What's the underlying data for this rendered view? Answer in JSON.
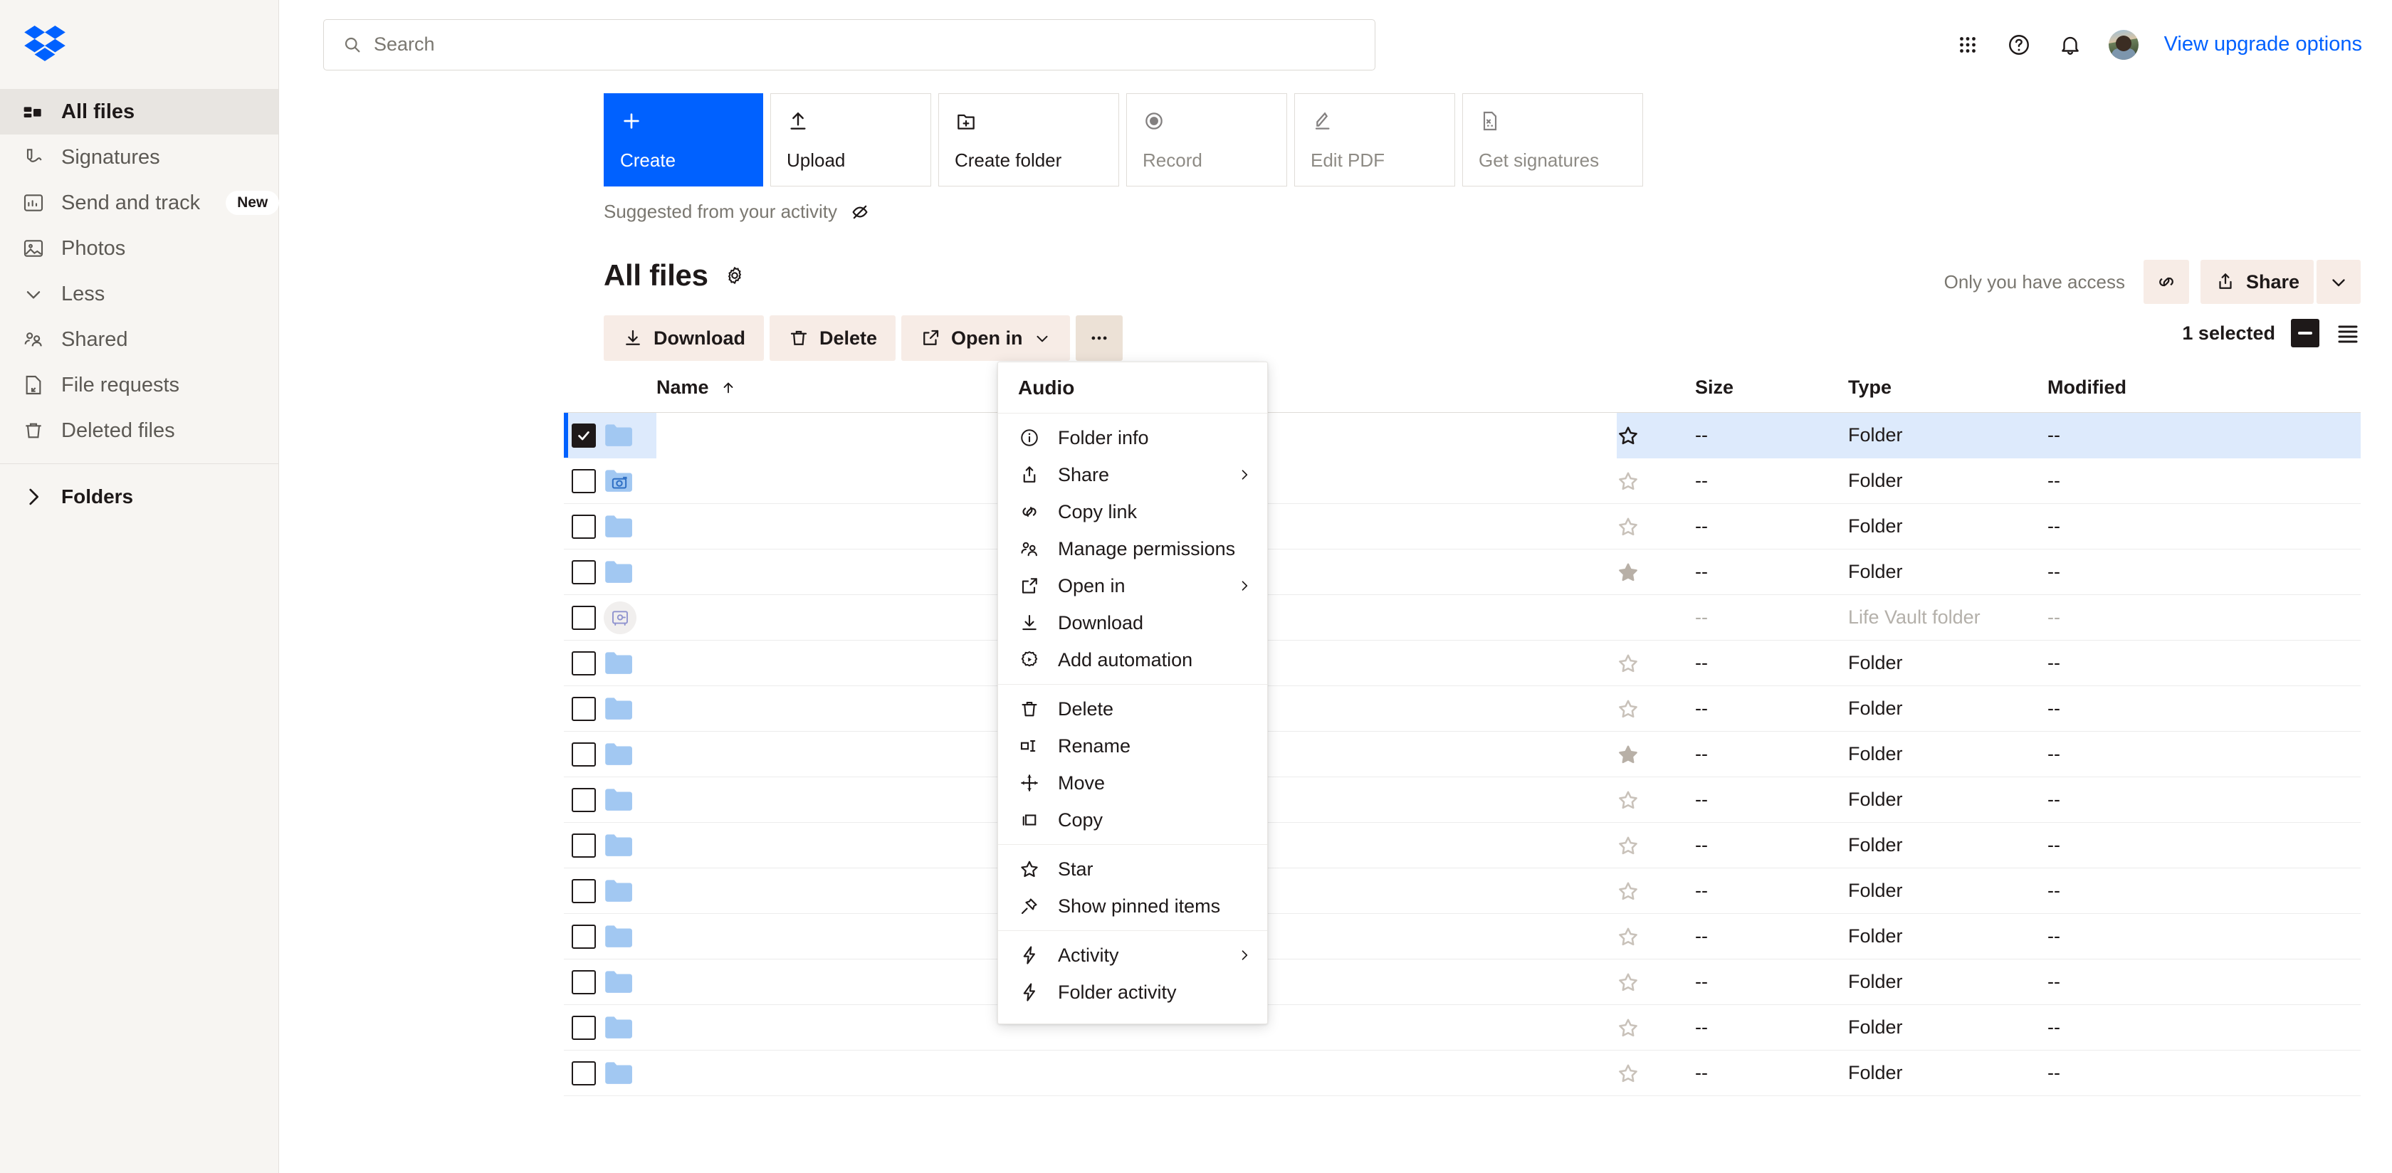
{
  "brand": {
    "name": "Dropbox",
    "accent": "#0061ff"
  },
  "sidebar": {
    "items": [
      {
        "label": "All files",
        "icon": "all-files-icon",
        "active": true,
        "badge": ""
      },
      {
        "label": "Signatures",
        "icon": "signature-icon",
        "active": false,
        "badge": ""
      },
      {
        "label": "Send and track",
        "icon": "send-track-icon",
        "active": false,
        "badge": "New"
      },
      {
        "label": "Photos",
        "icon": "photos-icon",
        "active": false,
        "badge": ""
      },
      {
        "label": "Less",
        "icon": "chevron-down-icon",
        "active": false,
        "badge": ""
      },
      {
        "label": "Shared",
        "icon": "shared-icon",
        "active": false,
        "badge": ""
      },
      {
        "label": "File requests",
        "icon": "file-request-icon",
        "active": false,
        "badge": ""
      },
      {
        "label": "Deleted files",
        "icon": "trash-icon",
        "active": false,
        "badge": ""
      }
    ],
    "folders_label": "Folders"
  },
  "topbar": {
    "search_placeholder": "Search",
    "upgrade_label": "View upgrade options",
    "icons": [
      "grid-apps-icon",
      "help-circle-icon",
      "bell-icon",
      "avatar"
    ]
  },
  "tiles": [
    {
      "label": "Create",
      "icon": "plus-icon",
      "primary": true,
      "disabled": false
    },
    {
      "label": "Upload",
      "icon": "upload-icon",
      "primary": false,
      "disabled": false
    },
    {
      "label": "Create folder",
      "icon": "folder-plus-icon",
      "primary": false,
      "disabled": false
    },
    {
      "label": "Record",
      "icon": "record-icon",
      "primary": false,
      "disabled": true
    },
    {
      "label": "Edit PDF",
      "icon": "pen-icon",
      "primary": false,
      "disabled": true
    },
    {
      "label": "Get signatures",
      "icon": "signature-doc-icon",
      "primary": false,
      "disabled": true
    }
  ],
  "suggested": {
    "label": "Suggested from your activity",
    "icon": "hide-eye-icon"
  },
  "page": {
    "title": "All files",
    "settings_icon": "gear-icon",
    "access_label": "Only you have access",
    "copy_link_icon": "link-icon",
    "share_label": "Share",
    "share_caret_icon": "chevron-down-icon"
  },
  "actionbar": {
    "download_label": "Download",
    "delete_label": "Delete",
    "open_in_label": "Open in",
    "more_label": "•••"
  },
  "selection": {
    "count_label": "1 selected",
    "deselect_icon": "minus-icon",
    "view_toggle_icon": "list-view-icon"
  },
  "table": {
    "headers": {
      "name": "Name",
      "size": "Size",
      "type": "Type",
      "modified": "Modified"
    },
    "sort": {
      "column": "Name",
      "direction": "asc",
      "icon": "arrow-up-icon"
    },
    "rows": [
      {
        "name": "",
        "icon": "folder-icon",
        "checked": true,
        "starred": "outline-dark",
        "size": "--",
        "type": "Folder",
        "modified": "--",
        "selected": true,
        "dim": false
      },
      {
        "name": "",
        "icon": "camera-folder-icon",
        "checked": false,
        "starred": "outline",
        "size": "--",
        "type": "Folder",
        "modified": "--",
        "selected": false,
        "dim": false
      },
      {
        "name": "",
        "icon": "folder-icon",
        "checked": false,
        "starred": "outline",
        "size": "--",
        "type": "Folder",
        "modified": "--",
        "selected": false,
        "dim": false
      },
      {
        "name": "",
        "icon": "folder-icon",
        "checked": false,
        "starred": "filled",
        "size": "--",
        "type": "Folder",
        "modified": "--",
        "selected": false,
        "dim": false
      },
      {
        "name": "",
        "icon": "vault-icon",
        "checked": false,
        "starred": "none",
        "size": "--",
        "type": "Life Vault folder",
        "modified": "--",
        "selected": false,
        "dim": true
      },
      {
        "name": "",
        "icon": "folder-icon",
        "checked": false,
        "starred": "outline",
        "size": "--",
        "type": "Folder",
        "modified": "--",
        "selected": false,
        "dim": false
      },
      {
        "name": "",
        "icon": "folder-icon",
        "checked": false,
        "starred": "outline",
        "size": "--",
        "type": "Folder",
        "modified": "--",
        "selected": false,
        "dim": false
      },
      {
        "name": "",
        "icon": "folder-icon",
        "checked": false,
        "starred": "filled",
        "size": "--",
        "type": "Folder",
        "modified": "--",
        "selected": false,
        "dim": false
      },
      {
        "name": "",
        "icon": "folder-icon",
        "checked": false,
        "starred": "outline",
        "size": "--",
        "type": "Folder",
        "modified": "--",
        "selected": false,
        "dim": false
      },
      {
        "name": "",
        "icon": "folder-icon",
        "checked": false,
        "starred": "outline",
        "size": "--",
        "type": "Folder",
        "modified": "--",
        "selected": false,
        "dim": false
      },
      {
        "name": "",
        "icon": "folder-icon",
        "checked": false,
        "starred": "outline",
        "size": "--",
        "type": "Folder",
        "modified": "--",
        "selected": false,
        "dim": false
      },
      {
        "name": "",
        "icon": "folder-icon",
        "checked": false,
        "starred": "outline",
        "size": "--",
        "type": "Folder",
        "modified": "--",
        "selected": false,
        "dim": false
      },
      {
        "name": "",
        "icon": "folder-icon",
        "checked": false,
        "starred": "outline",
        "size": "--",
        "type": "Folder",
        "modified": "--",
        "selected": false,
        "dim": false
      },
      {
        "name": "",
        "icon": "folder-icon",
        "checked": false,
        "starred": "outline",
        "size": "--",
        "type": "Folder",
        "modified": "--",
        "selected": false,
        "dim": false
      },
      {
        "name": "",
        "icon": "folder-icon",
        "checked": false,
        "starred": "outline",
        "size": "--",
        "type": "Folder",
        "modified": "--",
        "selected": false,
        "dim": false
      }
    ]
  },
  "context_menu": {
    "title": "Audio",
    "groups": [
      [
        {
          "label": "Folder info",
          "icon": "info-icon",
          "submenu": false
        },
        {
          "label": "Share",
          "icon": "share-icon",
          "submenu": true
        },
        {
          "label": "Copy link",
          "icon": "link-icon",
          "submenu": false
        },
        {
          "label": "Manage permissions",
          "icon": "people-icon",
          "submenu": false
        },
        {
          "label": "Open in",
          "icon": "open-in-icon",
          "submenu": true
        },
        {
          "label": "Download",
          "icon": "download-icon",
          "submenu": false
        },
        {
          "label": "Add automation",
          "icon": "automation-icon",
          "submenu": false
        }
      ],
      [
        {
          "label": "Delete",
          "icon": "trash-icon",
          "submenu": false
        },
        {
          "label": "Rename",
          "icon": "rename-icon",
          "submenu": false
        },
        {
          "label": "Move",
          "icon": "move-icon",
          "submenu": false
        },
        {
          "label": "Copy",
          "icon": "copy-icon",
          "submenu": false
        }
      ],
      [
        {
          "label": "Star",
          "icon": "star-icon",
          "submenu": false
        },
        {
          "label": "Show pinned items",
          "icon": "pin-icon",
          "submenu": false
        }
      ],
      [
        {
          "label": "Activity",
          "icon": "bolt-icon",
          "submenu": true
        },
        {
          "label": "Folder activity",
          "icon": "bolt-icon",
          "submenu": false
        }
      ]
    ]
  }
}
